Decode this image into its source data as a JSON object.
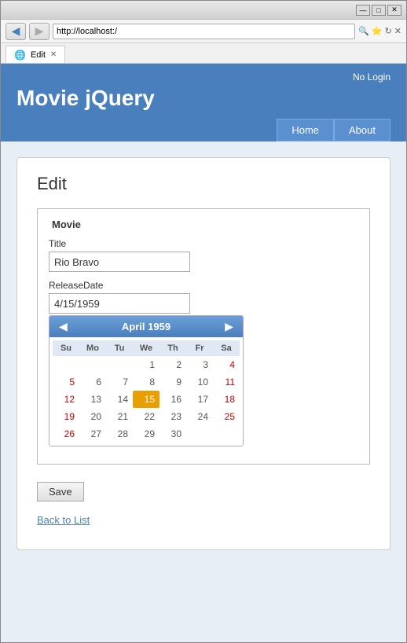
{
  "browser": {
    "title_bar_buttons": [
      "—",
      "□",
      "✕"
    ],
    "address": "http://localhost:/",
    "tab_label": "Edit",
    "tab_favicon": "🌐"
  },
  "app": {
    "title": "Movie jQuery",
    "no_login": "No Login",
    "nav": {
      "home_label": "Home",
      "about_label": "About"
    }
  },
  "page": {
    "title": "Edit",
    "fieldset_legend": "Movie",
    "title_label": "Title",
    "title_value": "Rio Bravo",
    "release_label": "ReleaseDate",
    "release_value": "4/15/1959",
    "save_label": "Save",
    "back_link": "Back to List"
  },
  "calendar": {
    "header": "April 1959",
    "days_header": [
      "Su",
      "Mo",
      "Tu",
      "We",
      "Th",
      "Fr",
      "Sa"
    ],
    "weeks": [
      [
        "",
        "",
        "",
        "1",
        "2",
        "3",
        "4"
      ],
      [
        "5",
        "6",
        "7",
        "8",
        "9",
        "10",
        "11"
      ],
      [
        "12",
        "13",
        "14",
        "15",
        "16",
        "17",
        "18"
      ],
      [
        "19",
        "20",
        "21",
        "22",
        "23",
        "24",
        "25"
      ],
      [
        "26",
        "27",
        "28",
        "29",
        "30",
        "",
        ""
      ]
    ],
    "selected_day": "15",
    "weekend_cols": [
      0,
      6
    ]
  }
}
